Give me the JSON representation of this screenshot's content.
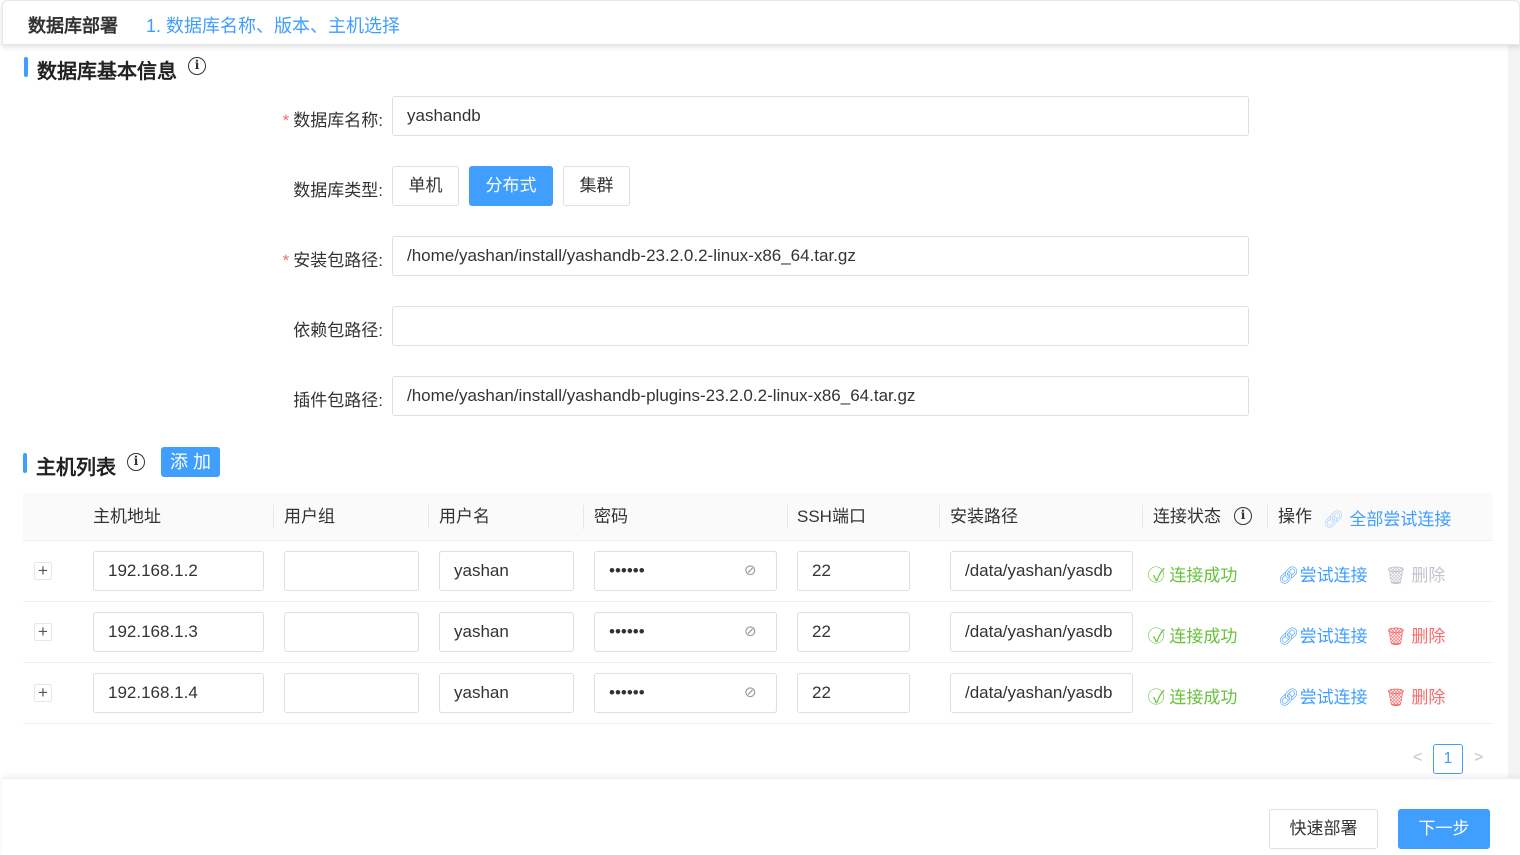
{
  "header": {
    "title": "数据库部署",
    "step": "1. 数据库名称、版本、主机选择"
  },
  "basic": {
    "title": "数据库基本信息",
    "name_label": "数据库名称:",
    "name_value": "yashandb",
    "type_label": "数据库类型:",
    "types": [
      "单机",
      "分布式",
      "集群"
    ],
    "selected_type": "分布式",
    "install_label": "安装包路径:",
    "install_value": "/home/yashan/install/yashandb-23.2.0.2-linux-x86_64.tar.gz",
    "dep_label": "依赖包路径:",
    "dep_value": "",
    "plugin_label": "插件包路径:",
    "plugin_value": "/home/yashan/install/yashandb-plugins-23.2.0.2-linux-x86_64.tar.gz",
    "required_mark": "*"
  },
  "hosts": {
    "title": "主机列表",
    "add_label": "添 加",
    "columns": [
      "主机地址",
      "用户组",
      "用户名",
      "密码",
      "SSH端口",
      "安装路径",
      "连接状态",
      "操作"
    ],
    "test_all_label": "全部尝试连接",
    "rows": [
      {
        "host": "192.168.1.2",
        "group": "",
        "user": "yashan",
        "password": "••••••",
        "port": "22",
        "path": "/data/yashan/yasdb",
        "status": "连接成功",
        "test": "尝试连接",
        "delete": "删除",
        "delete_disabled": true
      },
      {
        "host": "192.168.1.3",
        "group": "",
        "user": "yashan",
        "password": "••••••",
        "port": "22",
        "path": "/data/yashan/yasdb",
        "status": "连接成功",
        "test": "尝试连接",
        "delete": "删除",
        "delete_disabled": false
      },
      {
        "host": "192.168.1.4",
        "group": "",
        "user": "yashan",
        "password": "••••••",
        "port": "22",
        "path": "/data/yashan/yasdb",
        "status": "连接成功",
        "test": "尝试连接",
        "delete": "删除",
        "delete_disabled": false
      }
    ],
    "expand_symbol": "+",
    "pagination": {
      "current": "1",
      "prev": "<",
      "next": ">"
    }
  },
  "footer": {
    "quick_deploy": "快速部署",
    "next": "下一步"
  },
  "colors": {
    "primary": "#409eff",
    "success": "#67c23a",
    "danger": "#f56c6c"
  }
}
